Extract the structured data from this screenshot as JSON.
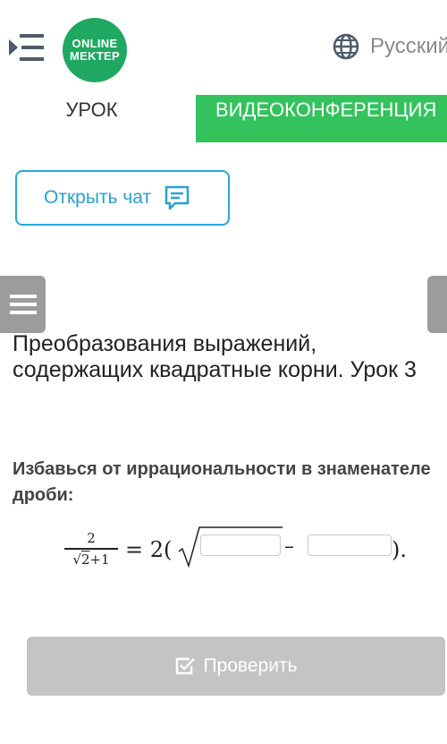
{
  "header": {
    "logo_line1": "ONLINE",
    "logo_line2": "MEKTEP",
    "language": "Русский",
    "icons": {
      "menu": "menu-collapse-icon",
      "language": "globe-icon"
    }
  },
  "tabs": {
    "lesson": "УРОК",
    "video": "ВИДЕОКОНФЕРЕНЦИЯ"
  },
  "chat": {
    "label": "Открыть чат",
    "icon": "chat-icon"
  },
  "lesson": {
    "title": "Преобразования выражений, содержащих квадратные корни. Урок 3",
    "task": "Избавься от иррациональности в знаменателе дроби:"
  },
  "formula": {
    "numerator": "2",
    "denominator_radicand": "2",
    "denominator_rest": "+1",
    "equals": "= 2(",
    "minus": "–",
    "closing": ")."
  },
  "check_button": {
    "label": "Проверить",
    "icon": "checkbox-icon"
  },
  "colors": {
    "brand": "#1fa862",
    "video_tab": "#34c25c",
    "link": "#2a9fd0",
    "disabled": "#c4c4c4"
  }
}
